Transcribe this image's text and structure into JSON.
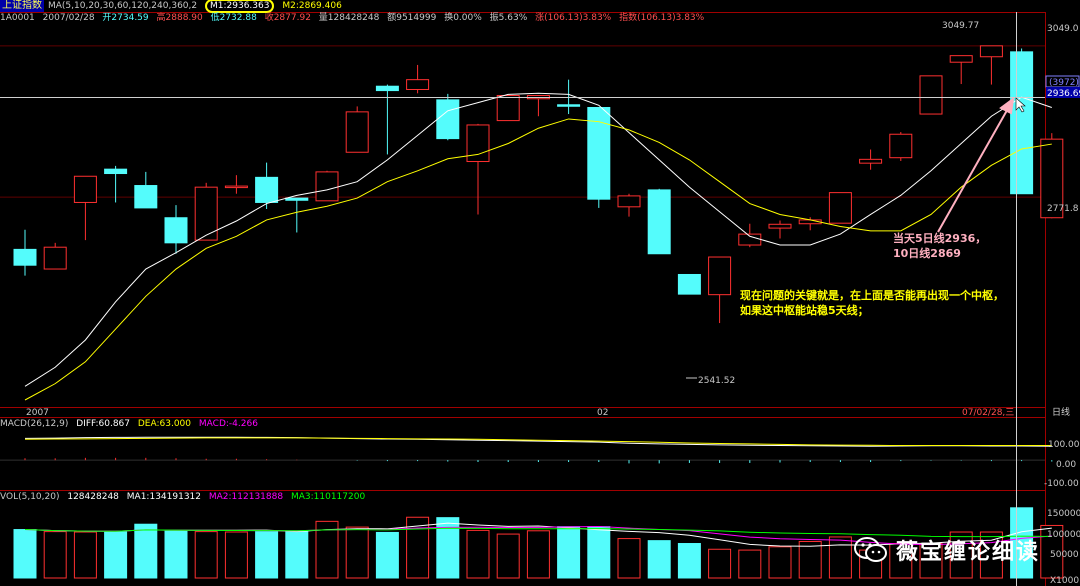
{
  "window": {
    "title": "上证指数",
    "symbol": "1A0001",
    "date": "2007/02/28",
    "open": "开2734.59",
    "high": "高2888.90",
    "low": "低2732.88",
    "close": "收2877.92",
    "volume": "量128428248",
    "amount": "额9514999",
    "turnover": "换0.00%",
    "amplitude": "振5.63%",
    "change": "涨(106.13)3.83%",
    "index_change": "指数(106.13)3.83%"
  },
  "ma_header": {
    "label": "MA(5,10,20,30,60,120,240,360,2",
    "m1": "M1:2936.363",
    "m2": "M2:2869.406"
  },
  "macd_header": {
    "label": "MACD(26,12,9)",
    "diff": "DIFF:60.867",
    "dea": "DEA:63.000",
    "macd": "MACD:-4.266"
  },
  "vol_header": {
    "label": "VOL(5,10,20)",
    "vol": "128428248",
    "ma1": "MA1:134191312",
    "ma2": "MA2:112131888",
    "ma3": "MA3:110117200"
  },
  "axis": {
    "price_ticks": [
      "3049.0",
      "2936.69",
      "2771.8"
    ],
    "price_label_box": "(3972)",
    "macd_ticks": [
      "100.00",
      "0.00",
      "-100.00"
    ],
    "vol_ticks": [
      "150000",
      "100000",
      "50000",
      "X1000"
    ],
    "x_start": "2007",
    "x_mid": "02",
    "x_cursor": "07/02/28,三",
    "period": "日线"
  },
  "annotations": {
    "high_label": "3049.77",
    "low_label": "2541.52",
    "arrow_text_1": "当天5日线2936，",
    "arrow_text_2": "10日线2869",
    "note_1": "现在问题的关键就是，在上面是否能再出现一个中枢，",
    "note_2": "如果这中枢能站稳5天线；"
  },
  "watermark": "薇宝缠论细读",
  "colors": {
    "up": "#ff3030",
    "down": "#54fcfc",
    "ma5": "#ffffff",
    "ma10": "#ffff00",
    "ma20": "#ff00ff",
    "ma30": "#00ff00",
    "arrow": "#ffb0c0"
  },
  "chart_data": {
    "type": "candlestick",
    "ylim": [
      2400,
      3100
    ],
    "candles": [
      {
        "o": 2676,
        "h": 2712,
        "l": 2628,
        "c": 2647
      },
      {
        "o": 2640,
        "h": 2688,
        "l": 2640,
        "c": 2680
      },
      {
        "o": 2762,
        "h": 2810,
        "l": 2693,
        "c": 2810
      },
      {
        "o": 2823,
        "h": 2829,
        "l": 2762,
        "c": 2815
      },
      {
        "o": 2793,
        "h": 2818,
        "l": 2783,
        "c": 2752
      },
      {
        "o": 2734,
        "h": 2757,
        "l": 2668,
        "c": 2688
      },
      {
        "o": 2693,
        "h": 2798,
        "l": 2693,
        "c": 2790
      },
      {
        "o": 2790,
        "h": 2812,
        "l": 2778,
        "c": 2792
      },
      {
        "o": 2808,
        "h": 2835,
        "l": 2750,
        "c": 2762
      },
      {
        "o": 2770,
        "h": 2766,
        "l": 2707,
        "c": 2766
      },
      {
        "o": 2765,
        "h": 2820,
        "l": 2765,
        "c": 2818
      },
      {
        "o": 2854,
        "h": 2938,
        "l": 2854,
        "c": 2928
      },
      {
        "o": 2975,
        "h": 2978,
        "l": 2850,
        "c": 2967
      },
      {
        "o": 2969,
        "h": 3014,
        "l": 2962,
        "c": 2987
      },
      {
        "o": 2950,
        "h": 2961,
        "l": 2876,
        "c": 2879
      },
      {
        "o": 2837,
        "h": 2906,
        "l": 2740,
        "c": 2904
      },
      {
        "o": 2912,
        "h": 2947,
        "l": 2928,
        "c": 2958
      },
      {
        "o": 2952,
        "h": 2950,
        "l": 2920,
        "c": 2958
      },
      {
        "o": 2941,
        "h": 2987,
        "l": 2924,
        "c": 2939
      },
      {
        "o": 2936,
        "h": 2937,
        "l": 2752,
        "c": 2768
      },
      {
        "o": 2754,
        "h": 2778,
        "l": 2736,
        "c": 2774
      },
      {
        "o": 2785,
        "h": 2787,
        "l": 2670,
        "c": 2668
      },
      {
        "o": 2630,
        "h": 2630,
        "l": 2594,
        "c": 2594
      },
      {
        "o": 2593,
        "h": 2661,
        "l": 2541,
        "c": 2662
      },
      {
        "o": 2684,
        "h": 2723,
        "l": 2680,
        "c": 2704
      },
      {
        "o": 2715,
        "h": 2729,
        "l": 2696,
        "c": 2722
      },
      {
        "o": 2723,
        "h": 2735,
        "l": 2711,
        "c": 2730
      },
      {
        "o": 2724,
        "h": 2780,
        "l": 2724,
        "c": 2780
      },
      {
        "o": 2834,
        "h": 2859,
        "l": 2822,
        "c": 2841
      },
      {
        "o": 2844,
        "h": 2891,
        "l": 2838,
        "c": 2887
      },
      {
        "o": 2924,
        "h": 2990,
        "l": 2924,
        "c": 2994
      },
      {
        "o": 3019,
        "h": 3029,
        "l": 2979,
        "c": 3031
      },
      {
        "o": 3029,
        "h": 3049,
        "l": 2978,
        "c": 3049
      },
      {
        "o": 3038,
        "h": 3044,
        "l": 2779,
        "c": 2778
      },
      {
        "o": 2734,
        "h": 2889,
        "l": 2733,
        "c": 2878
      }
    ],
    "ma5": [
      2425,
      2460,
      2510,
      2580,
      2640,
      2670,
      2702,
      2728,
      2760,
      2775,
      2785,
      2800,
      2840,
      2885,
      2930,
      2945,
      2960,
      2962,
      2960,
      2940,
      2890,
      2840,
      2790,
      2745,
      2700,
      2684,
      2684,
      2704,
      2740,
      2775,
      2820,
      2870,
      2920,
      2955,
      2936
    ],
    "ma10": [
      2400,
      2430,
      2470,
      2530,
      2590,
      2640,
      2678,
      2700,
      2730,
      2744,
      2755,
      2770,
      2800,
      2820,
      2842,
      2850,
      2870,
      2898,
      2915,
      2910,
      2895,
      2872,
      2840,
      2800,
      2760,
      2740,
      2730,
      2718,
      2710,
      2710,
      2740,
      2790,
      2830,
      2860,
      2869
    ],
    "volume": [
      118,
      113,
      112,
      112,
      131,
      114,
      113,
      112,
      113,
      113,
      138,
      124,
      111,
      148,
      147,
      116,
      107,
      115,
      125,
      125,
      96,
      91,
      84,
      70,
      68,
      76,
      89,
      100,
      68,
      84,
      84,
      112,
      112,
      171,
      128
    ],
    "vol_ylim": [
      0,
      190
    ],
    "macd_diff": [
      94,
      95,
      97,
      98,
      99,
      99,
      99,
      99,
      98,
      97,
      95,
      93,
      91,
      90,
      88,
      86,
      84,
      82,
      80,
      78,
      73,
      70,
      68,
      66,
      64,
      63,
      62,
      61,
      60,
      61,
      62,
      62,
      61,
      61,
      60
    ],
    "macd_dea": [
      90,
      91,
      92,
      93,
      94,
      95,
      96,
      96,
      96,
      96,
      95,
      94,
      93,
      92,
      91,
      90,
      88,
      86,
      84,
      82,
      80,
      77,
      74,
      72,
      70,
      68,
      66,
      65,
      64,
      63,
      63,
      63,
      63,
      63,
      63
    ],
    "macd_ylim": [
      -120,
      130
    ]
  }
}
